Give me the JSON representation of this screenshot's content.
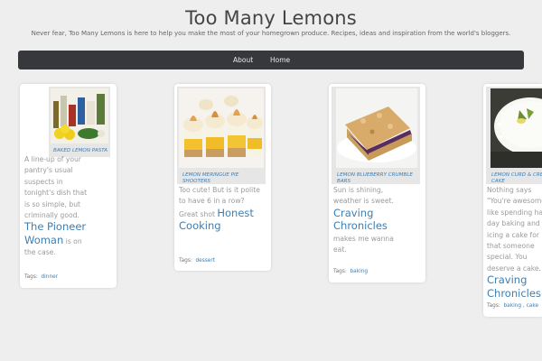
{
  "site": {
    "title": "Too Many Lemons",
    "tagline": "Never fear, Too Many Lemons is here to help you make the most of your homegrown produce. Recipes, ideas and inspiration from the world's bloggers."
  },
  "nav": {
    "items": [
      "About",
      "Home"
    ]
  },
  "colors": {
    "navbar": "#36383b",
    "link": "#3b7fb6",
    "page_bg": "#eeeeee"
  },
  "posts": [
    {
      "caption": "BAKED LEMON PASTA",
      "text_before": "A line-up of your pantry's usual suspects in tonight's dish that is so simple, but criminally good.",
      "link": "The Pioneer Woman",
      "text_after": "is on the case.",
      "tags_label": "Tags:",
      "tags": [
        "dinner"
      ]
    },
    {
      "caption": "LEMON MERINGUE PIE SHOOTERS",
      "text_before": "Too cute! But is it polite to have 6 in a row? Great shot",
      "link": "Honest Cooking",
      "text_after": "",
      "tags_label": "Tags:",
      "tags": [
        "dessert"
      ]
    },
    {
      "caption": "LEMON BLUEBERRY CRUMBLE BARS",
      "text_before": "Sun is shining, weather is sweet.",
      "link": "Craving Chronicles",
      "text_after": "makes me wanna eat.",
      "tags_label": "Tags:",
      "tags": [
        "baking"
      ]
    },
    {
      "caption": "LEMON CURD & CREAM CAKE",
      "text_before": "Nothing says \"You're awesome\" like spending half a day baking and icing a cake for that someone special. You deserve a cake.",
      "link": "Craving Chronicles",
      "text_after": "",
      "tags_label": "Tags:",
      "tags": [
        "baking",
        "cake"
      ]
    }
  ]
}
